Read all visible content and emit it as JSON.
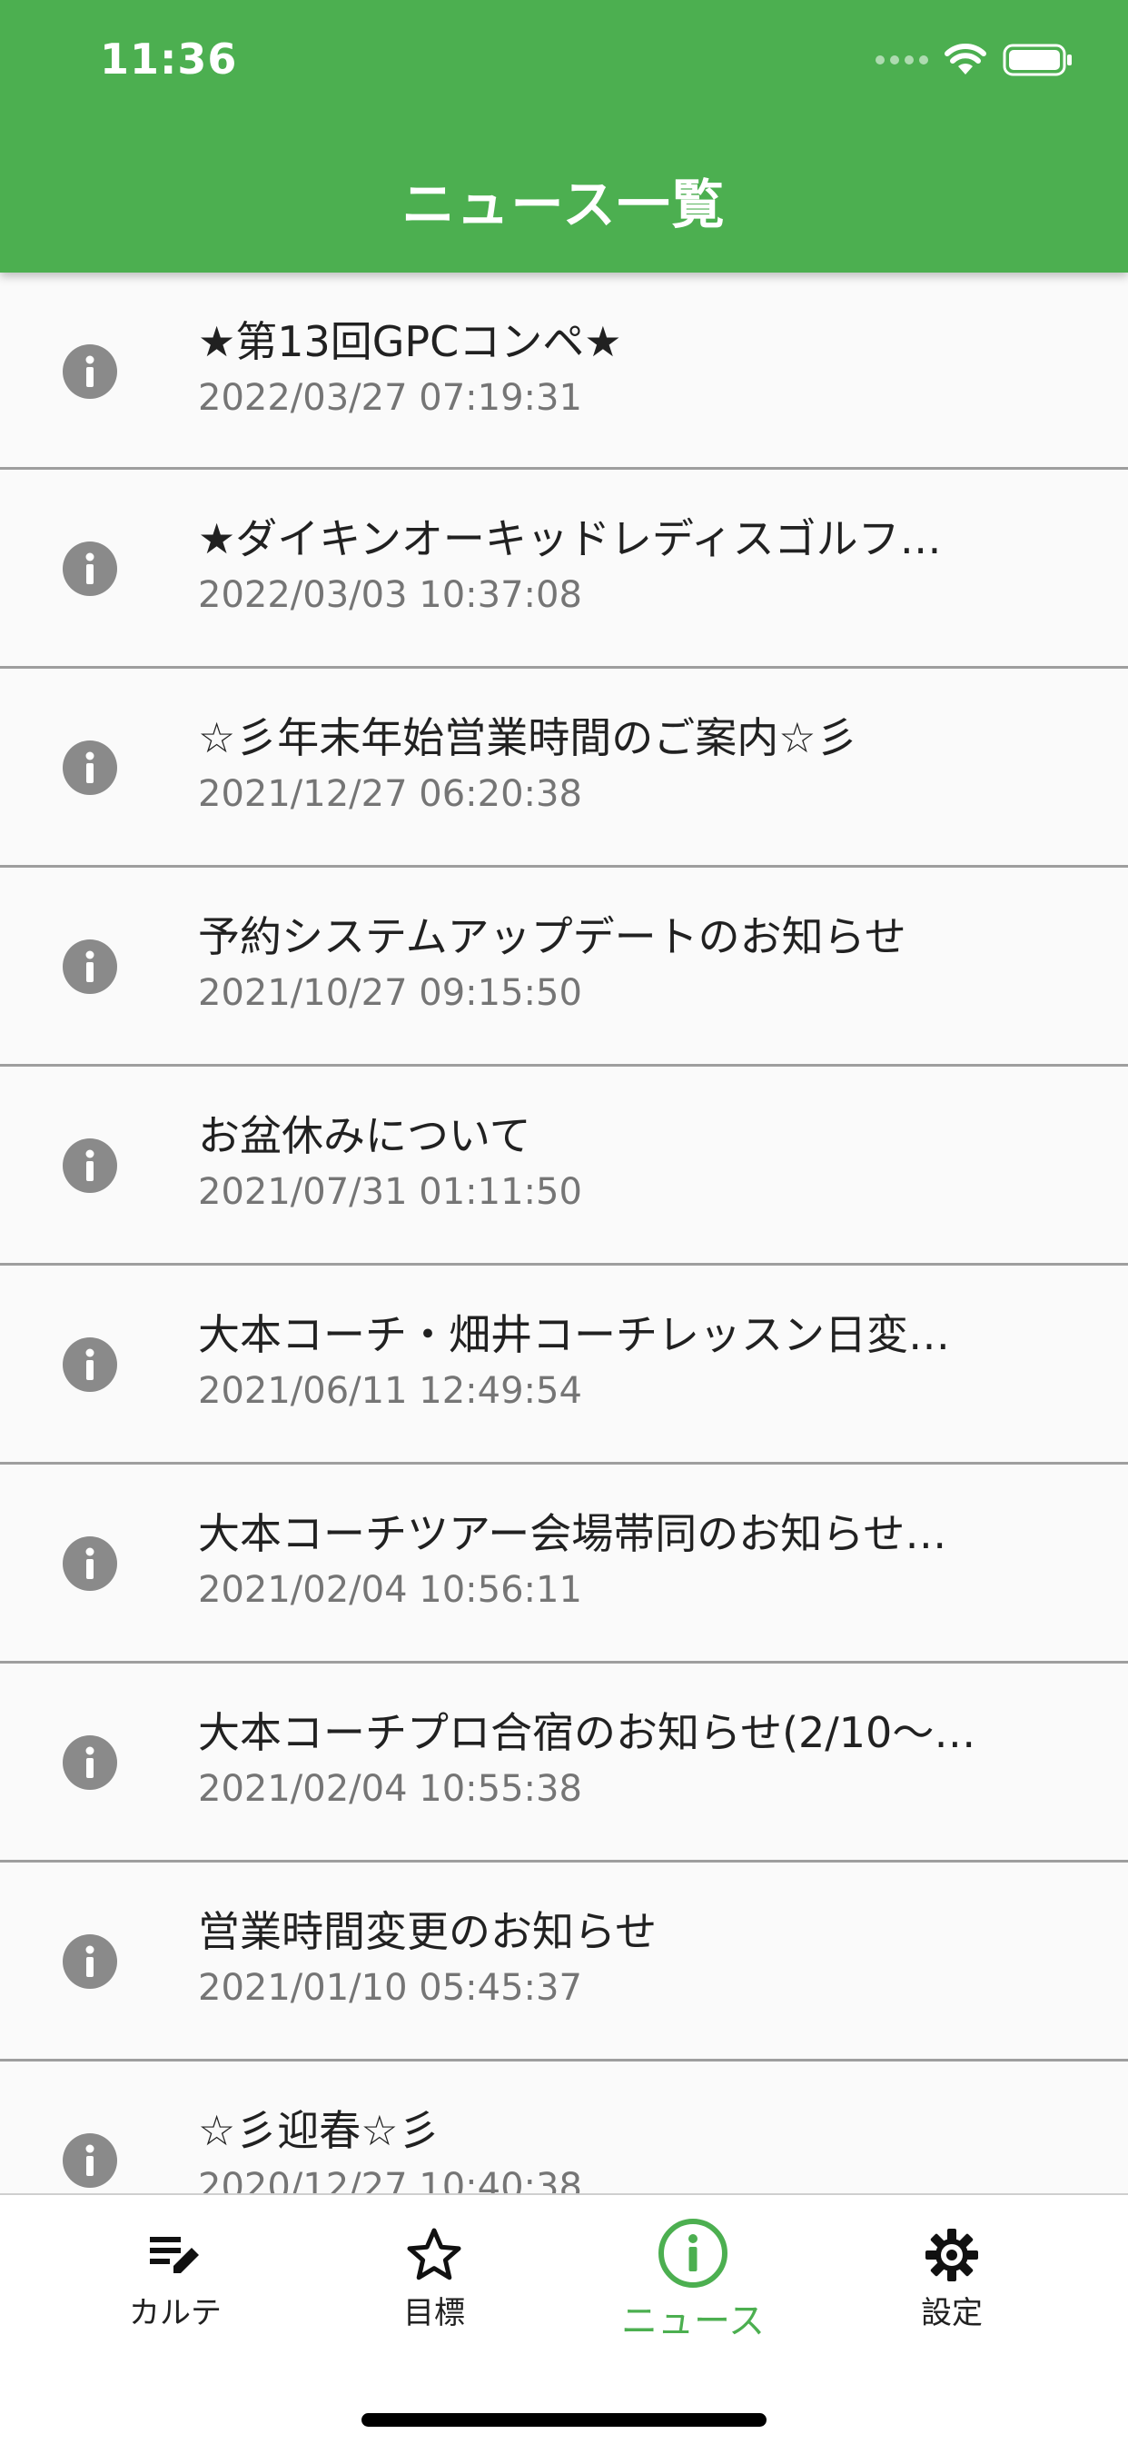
{
  "status_bar": {
    "time": "11:36"
  },
  "header": {
    "title": "ニュース一覧"
  },
  "news": [
    {
      "title": "★第13回GPCコンペ★",
      "date": "2022/03/27 07:19:31"
    },
    {
      "title": "★ダイキンオーキッドレディスゴルフ…",
      "date": "2022/03/03 10:37:08"
    },
    {
      "title": "☆彡年末年始営業時間のご案内☆彡",
      "date": "2021/12/27 06:20:38"
    },
    {
      "title": "予約システムアップデートのお知らせ",
      "date": "2021/10/27 09:15:50"
    },
    {
      "title": "お盆休みについて",
      "date": "2021/07/31 01:11:50"
    },
    {
      "title": "大本コーチ・畑井コーチレッスン日変…",
      "date": "2021/06/11 12:49:54"
    },
    {
      "title": "大本コーチツアー会場帯同のお知らせ…",
      "date": "2021/02/04 10:56:11"
    },
    {
      "title": "大本コーチプロ合宿のお知らせ(2/10〜…",
      "date": "2021/02/04 10:55:38"
    },
    {
      "title": "営業時間変更のお知らせ",
      "date": "2021/01/10 05:45:37"
    },
    {
      "title": "☆彡迎春☆彡",
      "date": "2020/12/27 10:40:38"
    }
  ],
  "bottom_nav": {
    "items": [
      {
        "label": "カルテ",
        "icon": "edit-list-icon"
      },
      {
        "label": "目標",
        "icon": "star-outline-icon"
      },
      {
        "label": "ニュース",
        "icon": "info-circle-icon",
        "active": true
      },
      {
        "label": "設定",
        "icon": "gear-icon"
      }
    ]
  },
  "colors": {
    "primary": "#4caf50",
    "icon_gray": "#8a8a8a",
    "date_gray": "#757575"
  }
}
